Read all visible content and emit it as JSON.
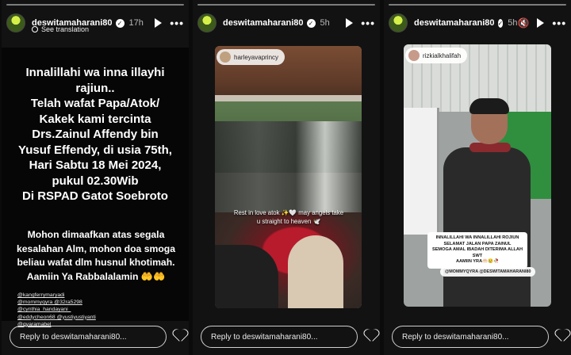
{
  "stories": [
    {
      "username": "deswitamaharani80",
      "time": "17h",
      "see_translation": "See translation",
      "main_lines": [
        "Innalillahi wa inna illayhi",
        "rajiun..",
        "Telah wafat Papa/Atok/",
        "Kakek kami tercinta",
        "Drs.Zainul Affendy bin",
        "Yusuf Effendy, di usia 75th,",
        "Hari Sabtu 18 Mei 2024,",
        "pukul 02.30Wib",
        "Di RSPAD Gatot Soebroto"
      ],
      "sub_lines": [
        "Mohon dimaafkan atas segala",
        "kesalahan Alm, mohon doa smoga",
        "beliau wafat dlm husnul khotimah.",
        "Aamiin Ya Rabbalalamin 🤲🤲"
      ],
      "mentions": [
        "@kangferrymaryadi",
        "@mommyqyra @32ra5298",
        "@cynthia_handayani_",
        "@eddycheon68 @yustiyustiyanti",
        "@qyaramabel"
      ],
      "reply_placeholder": "Reply to deswitamaharani80..."
    },
    {
      "username": "deswitamaharani80",
      "time": "5h",
      "tagged_user": "harleyavaprincy",
      "caption_lines": [
        "Rest in love atok ✨🤍 may angels take",
        "u straight to heaven 🕊️"
      ],
      "reply_placeholder": "Reply to deswitamaharani80..."
    },
    {
      "username": "deswitamaharani80",
      "time": "5h",
      "tagged_user": "rizkialkhalifah",
      "caption_lines": [
        "INNALILLAHI WA INNALILLAHI ROJIUN",
        "SELAMAT JALAN PAPA ZAINUL",
        "SEMOGA AMAL IBADAH DITERIMA ALLAH SWT",
        "AAMIIN YRA🤲🏻😢🥀"
      ],
      "mention_pill": "@MOMMYQYRA @DESWITAMAHARANI80",
      "reply_placeholder": "Reply to deswitamaharani80..."
    }
  ]
}
